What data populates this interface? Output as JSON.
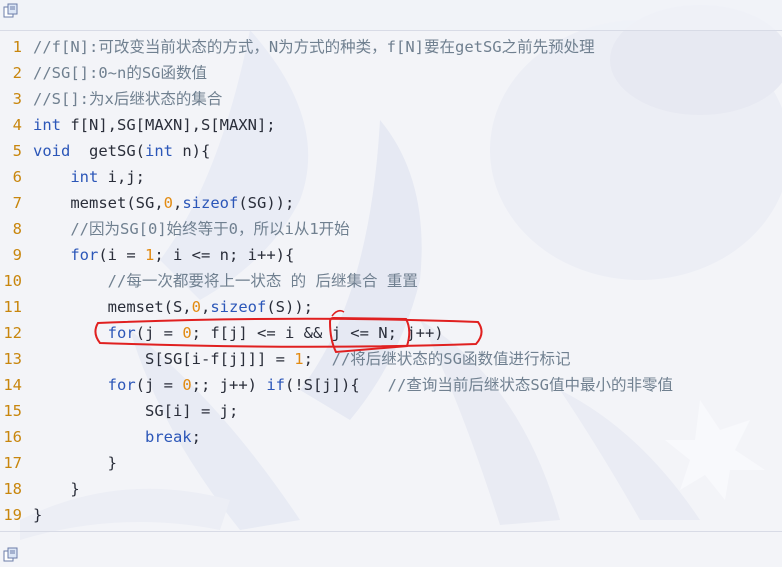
{
  "toolbar": {
    "copy_icon": "copy-icon"
  },
  "colors": {
    "line_number": "#c8860d",
    "comment": "#708090",
    "keyword": "#2b56b8",
    "number": "#e28b12",
    "text": "#2a2e3a",
    "annotation": "#e02020"
  },
  "code_lines": [
    {
      "n": "1",
      "tokens": [
        [
          "c",
          "//f[N]:可改变当前状态的方式，N为方式的种类，f[N]要在getSG之前先预处理"
        ]
      ]
    },
    {
      "n": "2",
      "tokens": [
        [
          "c",
          "//SG[]:0~n的SG函数值"
        ]
      ]
    },
    {
      "n": "3",
      "tokens": [
        [
          "c",
          "//S[]:为x后继状态的集合"
        ]
      ]
    },
    {
      "n": "4",
      "tokens": [
        [
          "k",
          "int"
        ],
        [
          "t",
          " f[N],SG[MAXN],S[MAXN];"
        ]
      ]
    },
    {
      "n": "5",
      "tokens": [
        [
          "k",
          "void"
        ],
        [
          "t",
          "  getSG("
        ],
        [
          "k",
          "int"
        ],
        [
          "t",
          " n){"
        ]
      ]
    },
    {
      "n": "6",
      "tokens": [
        [
          "t",
          "    "
        ],
        [
          "k",
          "int"
        ],
        [
          "t",
          " i,j;"
        ]
      ]
    },
    {
      "n": "7",
      "tokens": [
        [
          "t",
          "    memset(SG,"
        ],
        [
          "n",
          "0"
        ],
        [
          "t",
          ","
        ],
        [
          "k",
          "sizeof"
        ],
        [
          "t",
          "(SG));"
        ]
      ]
    },
    {
      "n": "8",
      "tokens": [
        [
          "t",
          "    "
        ],
        [
          "c",
          "//因为SG[0]始终等于0，所以i从1开始"
        ]
      ]
    },
    {
      "n": "9",
      "tokens": [
        [
          "t",
          "    "
        ],
        [
          "k",
          "for"
        ],
        [
          "t",
          "(i = "
        ],
        [
          "n",
          "1"
        ],
        [
          "t",
          "; i <= n; i++){"
        ]
      ]
    },
    {
      "n": "10",
      "tokens": [
        [
          "t",
          "        "
        ],
        [
          "c",
          "//每一次都要将上一状态 的 后继集合 重置"
        ]
      ]
    },
    {
      "n": "11",
      "tokens": [
        [
          "t",
          "        memset(S,"
        ],
        [
          "n",
          "0"
        ],
        [
          "t",
          ","
        ],
        [
          "k",
          "sizeof"
        ],
        [
          "t",
          "(S));"
        ]
      ]
    },
    {
      "n": "12",
      "tokens": [
        [
          "t",
          "        "
        ],
        [
          "k",
          "for"
        ],
        [
          "t",
          "(j = "
        ],
        [
          "n",
          "0"
        ],
        [
          "t",
          "; f[j] <= i && j <= N; j++)"
        ]
      ]
    },
    {
      "n": "13",
      "tokens": [
        [
          "t",
          "            S[SG[i-f[j]]] = "
        ],
        [
          "n",
          "1"
        ],
        [
          "t",
          ";  "
        ],
        [
          "c",
          "//将后继状态的SG函数值进行标记"
        ]
      ]
    },
    {
      "n": "14",
      "tokens": [
        [
          "t",
          "        "
        ],
        [
          "k",
          "for"
        ],
        [
          "t",
          "(j = "
        ],
        [
          "n",
          "0"
        ],
        [
          "t",
          ";; j++) "
        ],
        [
          "k",
          "if"
        ],
        [
          "t",
          "(!S[j]){   "
        ],
        [
          "c",
          "//查询当前后继状态SG值中最小的非零值"
        ]
      ]
    },
    {
      "n": "15",
      "tokens": [
        [
          "t",
          "            SG[i] = j;"
        ]
      ]
    },
    {
      "n": "16",
      "tokens": [
        [
          "t",
          "            "
        ],
        [
          "k",
          "break"
        ],
        [
          "t",
          ";"
        ]
      ]
    },
    {
      "n": "17",
      "tokens": [
        [
          "t",
          "        }"
        ]
      ]
    },
    {
      "n": "18",
      "tokens": [
        [
          "t",
          "    }"
        ]
      ]
    },
    {
      "n": "19",
      "tokens": [
        [
          "t",
          "}"
        ]
      ]
    }
  ]
}
